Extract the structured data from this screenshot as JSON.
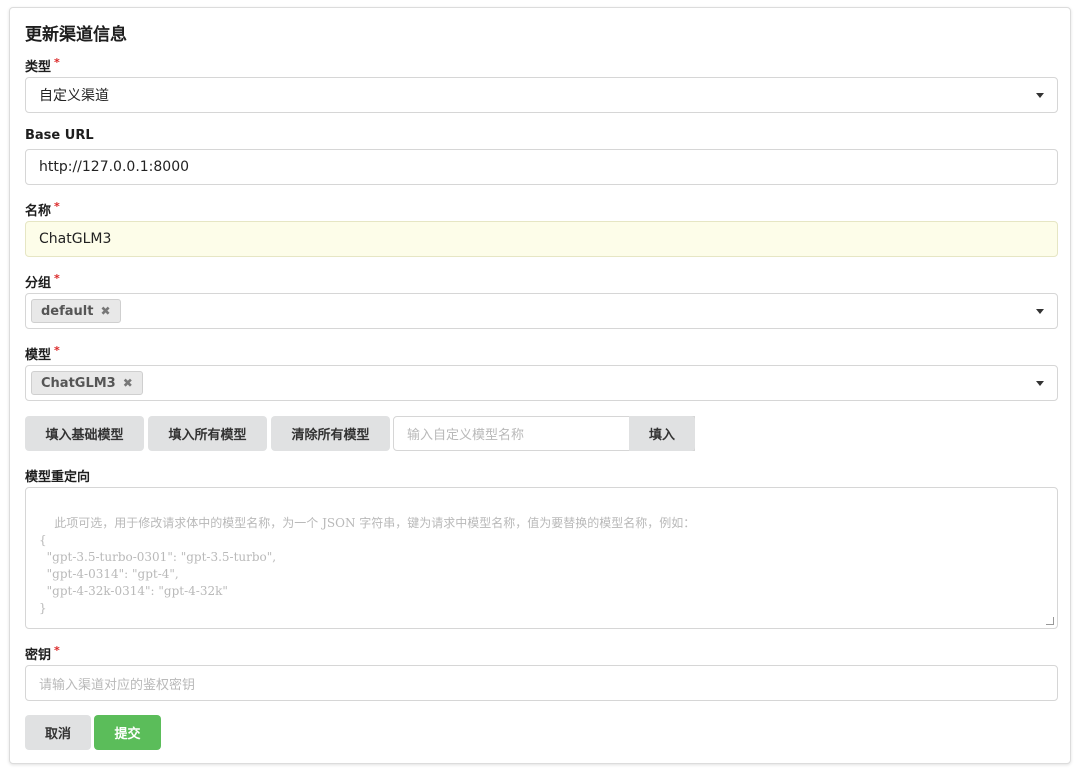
{
  "form": {
    "title": "更新渠道信息",
    "type": {
      "label": "类型",
      "required_mark": "*",
      "value": "自定义渠道"
    },
    "base_url": {
      "label": "Base URL",
      "value": "http://127.0.0.1:8000"
    },
    "name": {
      "label": "名称",
      "required_mark": "*",
      "value": "ChatGLM3"
    },
    "group": {
      "label": "分组",
      "required_mark": "*",
      "tags": [
        "default"
      ],
      "remove_glyph": "✖"
    },
    "models": {
      "label": "模型",
      "required_mark": "*",
      "tags": [
        "ChatGLM3"
      ],
      "remove_glyph": "✖"
    },
    "model_buttons": {
      "fill_basic": "填入基础模型",
      "fill_all": "填入所有模型",
      "clear_all": "清除所有模型",
      "custom_placeholder": "输入自定义模型名称",
      "fill": "填入"
    },
    "model_mapping": {
      "label": "模型重定向",
      "placeholder": "此项可选，用于修改请求体中的模型名称，为一个 JSON 字符串，键为请求中模型名称，值为要替换的模型名称，例如：\n{\n  \"gpt-3.5-turbo-0301\": \"gpt-3.5-turbo\",\n  \"gpt-4-0314\": \"gpt-4\",\n  \"gpt-4-32k-0314\": \"gpt-4-32k\"\n}"
    },
    "key": {
      "label": "密钥",
      "required_mark": "*",
      "placeholder": "请输入渠道对应的鉴权密钥"
    },
    "actions": {
      "cancel": "取消",
      "submit": "提交"
    }
  },
  "colors": {
    "submit": "#5bbd5a",
    "required": "#db2828",
    "name_highlight": "#fdfde9"
  }
}
